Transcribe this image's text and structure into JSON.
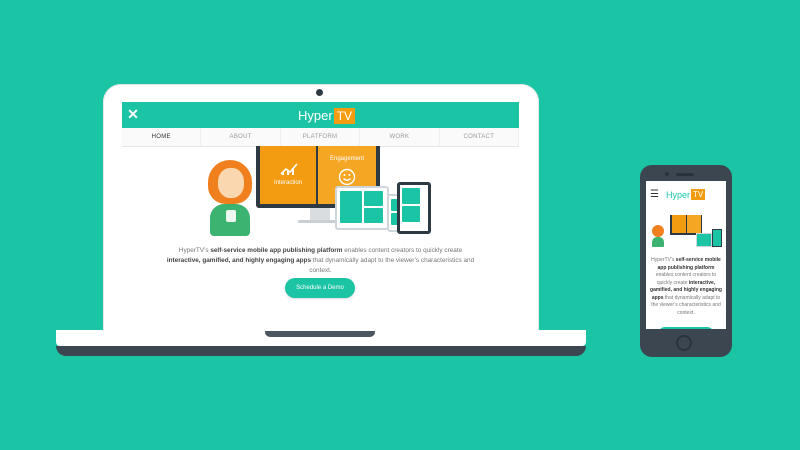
{
  "site": {
    "logo_text": "Hyper",
    "logo_badge": "TV",
    "close_icon": "✕",
    "nav": [
      "HOME",
      "ABOUT",
      "PLATFORM",
      "WORK",
      "CONTACT"
    ],
    "active_nav": "HOME",
    "hero_labels": {
      "interaction": "Interaction",
      "engagement": "Engagement"
    },
    "description": {
      "p1": "HyperTV’s ",
      "b1": "self-service mobile app publishing platform",
      "p2": " enables content creators to quickly create ",
      "b2": "interactive, gamified, and highly engaging apps",
      "p3": " that dynamically adapt to the viewer’s characteristics and context."
    },
    "cta_label": "Schedule a Demo"
  },
  "mobile": {
    "menu_icon": "☰",
    "logo_text": "Hyper",
    "logo_badge": "TV",
    "description": {
      "p1": "HyperTV’s ",
      "b1": "self-service mobile app publishing platform",
      "p2": " enables content creators to quickly create ",
      "b2": "interactive, gamified, and highly engaging apps",
      "p3": " that dynamically adapt to the viewer’s characteristics and context."
    }
  },
  "colors": {
    "background": "#1cc4a6",
    "accent": "#1cc4a6",
    "brand_orange": "#f39c12",
    "device_dark": "#3b4650"
  }
}
